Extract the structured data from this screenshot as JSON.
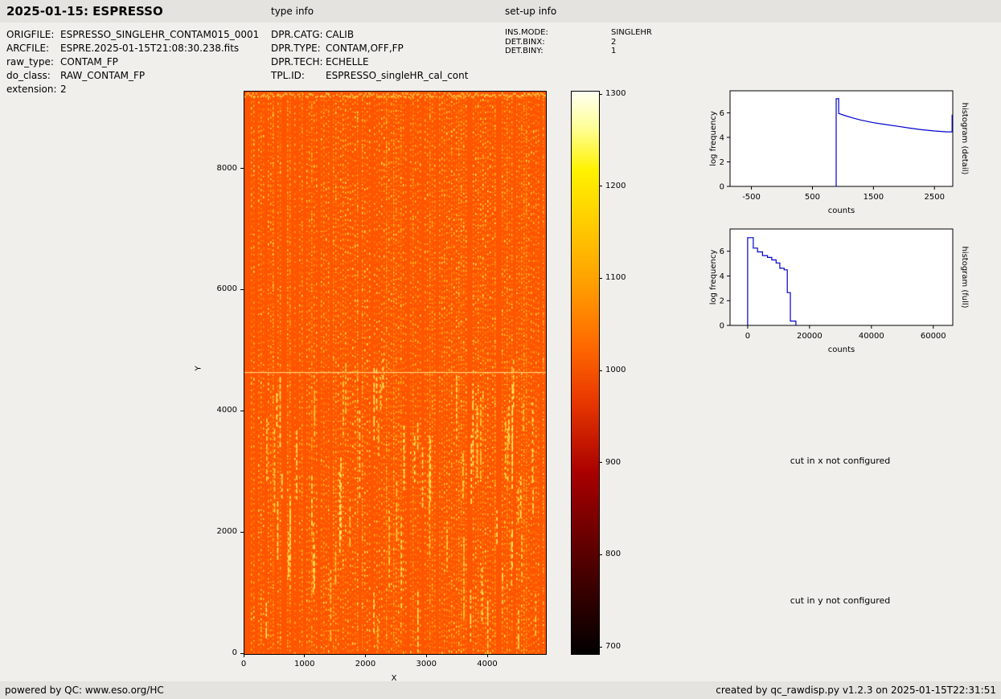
{
  "header": {
    "title": "2025-01-15: ESPRESSO",
    "type_info_label": "type info",
    "setup_info_label": "set-up info"
  },
  "file_info": {
    "rows": [
      {
        "label": "ORIGFILE:",
        "value": "ESPRESSO_SINGLEHR_CONTAM015_0001"
      },
      {
        "label": "ARCFILE:",
        "value": "ESPRE.2025-01-15T21:08:30.238.fits"
      },
      {
        "label": "raw_type:",
        "value": "CONTAM_FP"
      },
      {
        "label": "do_class:",
        "value": "RAW_CONTAM_FP"
      },
      {
        "label": "extension:",
        "value": "2"
      }
    ]
  },
  "type_info": {
    "rows": [
      {
        "label": "DPR.CATG:",
        "value": "CALIB"
      },
      {
        "label": "DPR.TYPE:",
        "value": "CONTAM,OFF,FP"
      },
      {
        "label": "DPR.TECH:",
        "value": "ECHELLE"
      },
      {
        "label": "TPL.ID:",
        "value": "ESPRESSO_singleHR_cal_cont"
      }
    ]
  },
  "setup_info": {
    "rows": [
      {
        "label": "INS.MODE:",
        "value": "SINGLEHR"
      },
      {
        "label": "DET.BINX:",
        "value": "2"
      },
      {
        "label": "DET.BINY:",
        "value": "1"
      }
    ]
  },
  "messages": {
    "cut_x": "cut in x not configured",
    "cut_y": "cut in y not configured"
  },
  "footer": {
    "left": "powered by QC: www.eso.org/HC",
    "right": "created by qc_rawdisp.py v1.2.3 on 2025-01-15T22:31:51"
  },
  "chart_data": [
    {
      "type": "heatmap",
      "name": "raw-frame",
      "title": "",
      "xlabel": "X",
      "ylabel": "Y",
      "xlim": [
        0,
        4950
      ],
      "ylim": [
        0,
        9280
      ],
      "xticks": [
        0,
        1000,
        2000,
        3000,
        4000
      ],
      "yticks": [
        0,
        2000,
        4000,
        6000,
        8000
      ],
      "colormap": "hot",
      "base_color": "#ff5400",
      "stripe_colors": [
        "#ffee55",
        "#ffc31e",
        "#ff8a00"
      ],
      "colorbar": {
        "vmin": 700,
        "vmax": 1300,
        "ticks": [
          700,
          800,
          900,
          1000,
          1100,
          1200,
          1300
        ]
      },
      "description": "ESPRESSO raw CONTAM_FP echelle frame: orange background near 1000 counts with yellow dotted vertical echelle-order stripes and a faint bright horizontal line near Y=4650"
    },
    {
      "type": "line",
      "name": "histogram-detail",
      "title": "histogram (detail)",
      "xlabel": "counts",
      "ylabel": "log frequency",
      "right_label": "histogram (detail)",
      "xlim": [
        -850,
        2800
      ],
      "ylim": [
        0,
        7.8
      ],
      "xticks": [
        -500,
        500,
        1500,
        2500
      ],
      "yticks": [
        0,
        2,
        4,
        6
      ],
      "line_color": "#0000cc",
      "points": [
        [
          890,
          0
        ],
        [
          890,
          7.15
        ],
        [
          930,
          7.15
        ],
        [
          930,
          5.95
        ],
        [
          1020,
          5.8
        ],
        [
          1150,
          5.6
        ],
        [
          1300,
          5.4
        ],
        [
          1500,
          5.2
        ],
        [
          1700,
          5.05
        ],
        [
          1900,
          4.9
        ],
        [
          2100,
          4.75
        ],
        [
          2300,
          4.62
        ],
        [
          2500,
          4.52
        ],
        [
          2700,
          4.45
        ],
        [
          2790,
          4.45
        ],
        [
          2790,
          5.85
        ]
      ]
    },
    {
      "type": "line",
      "name": "histogram-full",
      "title": "histogram (full)",
      "xlabel": "counts",
      "ylabel": "log frequency",
      "right_label": "histogram (full)",
      "xlim": [
        -5700,
        66300
      ],
      "ylim": [
        0,
        7.8
      ],
      "xticks": [
        0,
        20000,
        40000,
        60000
      ],
      "yticks": [
        0,
        2,
        4,
        6
      ],
      "line_color": "#0000cc",
      "points": [
        [
          0,
          0
        ],
        [
          0,
          7.1
        ],
        [
          1800,
          7.1
        ],
        [
          1800,
          6.25
        ],
        [
          3200,
          6.25
        ],
        [
          3200,
          5.95
        ],
        [
          4800,
          5.95
        ],
        [
          4800,
          5.65
        ],
        [
          6400,
          5.65
        ],
        [
          6400,
          5.5
        ],
        [
          7800,
          5.5
        ],
        [
          7800,
          5.3
        ],
        [
          9200,
          5.3
        ],
        [
          9200,
          5.05
        ],
        [
          10400,
          5.05
        ],
        [
          10400,
          4.62
        ],
        [
          11800,
          4.62
        ],
        [
          11800,
          4.5
        ],
        [
          12800,
          4.5
        ],
        [
          12800,
          2.65
        ],
        [
          13800,
          2.65
        ],
        [
          13800,
          0.35
        ],
        [
          15600,
          0.35
        ],
        [
          15600,
          0
        ]
      ]
    }
  ]
}
